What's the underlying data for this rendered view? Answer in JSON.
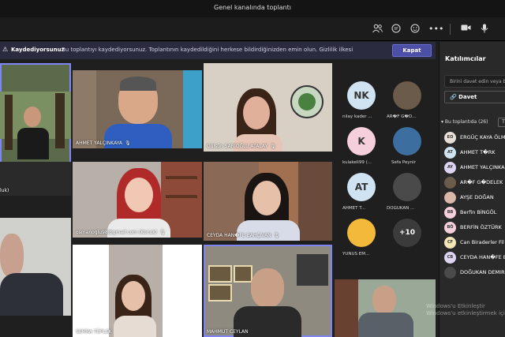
{
  "window": {
    "title": "Genel kanalında toplantı"
  },
  "toolbar": {
    "icons": [
      "participants-icon",
      "chat-icon",
      "reactions-icon",
      "more-icon",
      "camera-icon",
      "mic-icon"
    ]
  },
  "banner": {
    "title": "Kaydediyorsunuz",
    "message": "Bu toplantıyı kaydediyorsunuz. Toplantının kaydedildiğini herkese bildirdiğinizden emin olun. Gizlilik ilkesi",
    "close_label": "Kapat"
  },
  "tiles": [
    {
      "name": "AHMET YALÇINKAYA"
    },
    {
      "name": "Gülsün SARIOĞLU ATALAY"
    },
    {
      "name": "osmanoglu98@gmail.com (Konuk)"
    },
    {
      "name": "CEYDA HAN�FE BAHÇIVAN"
    },
    {
      "name": "SEMRA TÜPLEK"
    },
    {
      "name": "MAHMUT CEYLAN"
    },
    {
      "name": "luk)"
    }
  ],
  "avatars": [
    {
      "initials": "NK",
      "label": "nilay kader ...",
      "color": "#cfe3f2"
    },
    {
      "initials": "",
      "label": "AR�F G�D...",
      "color": "#6b5b4a"
    },
    {
      "initials": "K",
      "label": "kulakeli99 (...",
      "color": "#f5d0dc"
    },
    {
      "initials": "",
      "label": "Sefa Peynir",
      "color": "#3c6fa0"
    },
    {
      "initials": "AT",
      "label": "AHMET T...",
      "color": "#cfe3f2"
    },
    {
      "initials": "",
      "label": "DOĞUKAN ...",
      "color": "#4a4a4a"
    },
    {
      "initials": "",
      "label": "YUNUS EM...",
      "color": "#f2b93b"
    },
    {
      "initials": "+10",
      "label": "",
      "color": "#3b3b3b"
    }
  ],
  "panel": {
    "title": "Katılımcılar",
    "invite_placeholder": "Birini davet edin veya b",
    "share_label": "Davet",
    "section_label": "Bu toplantıda (26)",
    "participants": [
      {
        "initials": "EO",
        "name": "ERGÜÇ KAYA ÖLM",
        "color": "#e8e0d8"
      },
      {
        "initials": "AT",
        "name": "AHMET T�RK",
        "color": "#cfe3f2"
      },
      {
        "initials": "AY",
        "name": "AHMET YALÇINKA",
        "color": "#dcd4f0"
      },
      {
        "initials": "",
        "name": "AR�F G�DELEK",
        "color": "#6b5b4a"
      },
      {
        "initials": "",
        "name": "AYŞE DOĞAN",
        "color": "#d8b8a8"
      },
      {
        "initials": "BB",
        "name": "Berfin BİNGÖL",
        "color": "#f5d0dc"
      },
      {
        "initials": "BÖ",
        "name": "BERFİN ÖZTÜRK",
        "color": "#f5d0dc"
      },
      {
        "initials": "CF",
        "name": "Can Biraderler Fil",
        "color": "#f2e6b8"
      },
      {
        "initials": "CB",
        "name": "CEYDA HAN�FE B",
        "color": "#dcd4f0"
      },
      {
        "initials": "",
        "name": "DOĞUKAN DEMIR",
        "color": "#4a4a4a"
      }
    ]
  },
  "watermark": {
    "line1": "Windows'u Etkinleştir",
    "line2": "Windows'u etkinleştirmek için A"
  }
}
